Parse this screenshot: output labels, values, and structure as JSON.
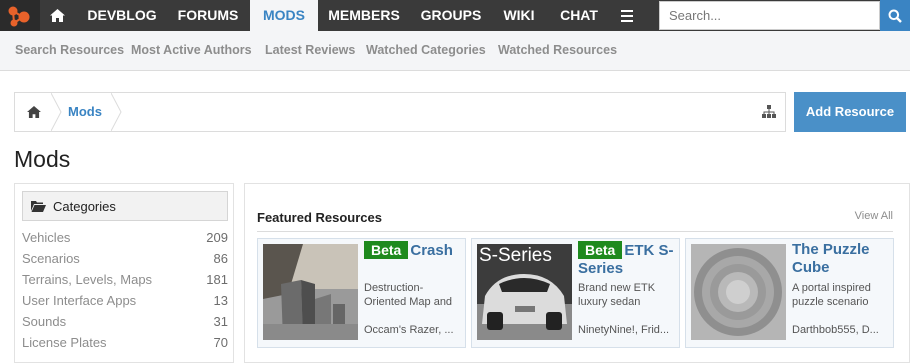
{
  "nav": {
    "tabs": [
      "DEVBLOG",
      "FORUMS",
      "MODS",
      "MEMBERS",
      "GROUPS",
      "WIKI",
      "CHAT"
    ],
    "active_tab": "MODS",
    "search_placeholder": "Search..."
  },
  "subnav": {
    "links": [
      "Search Resources",
      "Most Active Authors",
      "Latest Reviews",
      "Watched Categories",
      "Watched Resources"
    ]
  },
  "breadcrumb": {
    "current": "Mods"
  },
  "add_resource_label": "Add Resource",
  "page_title": "Mods",
  "sidebar": {
    "heading": "Categories",
    "categories": [
      {
        "name": "Vehicles",
        "count": "209"
      },
      {
        "name": "Scenarios",
        "count": "86"
      },
      {
        "name": "Terrains, Levels, Maps",
        "count": "181"
      },
      {
        "name": "User Interface Apps",
        "count": "13"
      },
      {
        "name": "Sounds",
        "count": "31"
      },
      {
        "name": "License Plates",
        "count": "70"
      }
    ]
  },
  "featured": {
    "title": "Featured Resources",
    "view_all": "View All",
    "cards": [
      {
        "badge": "Beta",
        "title": "Crash",
        "desc": "Destruction-Oriented Map and",
        "author": "Occam's Razer, ..."
      },
      {
        "badge": "Beta",
        "title": "ETK S-Series",
        "desc": "Brand new ETK luxury sedan",
        "author": "NinetyNine!, Frid...",
        "thumb_text": "S-Series"
      },
      {
        "badge": "",
        "title": "The Puzzle Cube",
        "desc": "A portal inspired puzzle scenario",
        "author": "Darthbob555, D..."
      }
    ]
  },
  "colors": {
    "nav_bg": "#3a3a3a",
    "accent": "#3a84c3",
    "badge_green": "#1e8a1e"
  },
  "icons": [
    "logo-icon",
    "home-icon",
    "menu-icon",
    "search-icon",
    "sitemap-icon",
    "folder-open-icon"
  ]
}
